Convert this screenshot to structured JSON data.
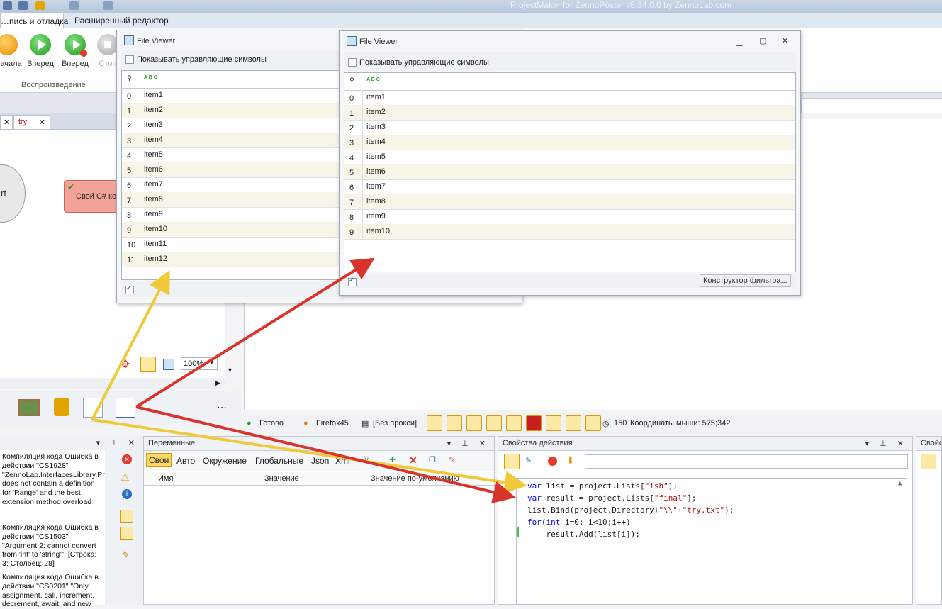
{
  "window": {
    "title": "ProjectMaker for ZennoPoster v5.34.0.0 by ZennoLab.com"
  },
  "ribbon": {
    "tabs": [
      {
        "label": "…пись и отладка"
      },
      {
        "label": "Расширенный редактор"
      }
    ],
    "buttons": [
      {
        "label": "…ачала"
      },
      {
        "label": "Вперед"
      },
      {
        "label": "Вперед"
      },
      {
        "label": "Стоп"
      }
    ],
    "group_label": "Воспроизведение"
  },
  "doc_tabs": [
    {
      "label": "try",
      "close": "✕"
    }
  ],
  "canvas": {
    "start_label": "rt",
    "action_label": "Свой C# ко",
    "zoom": "100%"
  },
  "file_viewer_1": {
    "title": "File Viewer",
    "show_control_chars": "Показывать управляющие символы",
    "header_icon": "A B C",
    "rows": [
      {
        "i": "0",
        "v": "item1"
      },
      {
        "i": "1",
        "v": "item2"
      },
      {
        "i": "2",
        "v": "item3"
      },
      {
        "i": "3",
        "v": "item4"
      },
      {
        "i": "4",
        "v": "item5"
      },
      {
        "i": "5",
        "v": "item6"
      },
      {
        "i": "6",
        "v": "item7"
      },
      {
        "i": "7",
        "v": "item8"
      },
      {
        "i": "8",
        "v": "item9"
      },
      {
        "i": "9",
        "v": "item10"
      },
      {
        "i": "10",
        "v": "item11"
      },
      {
        "i": "11",
        "v": "item12"
      }
    ]
  },
  "file_viewer_2": {
    "title": "File Viewer",
    "show_control_chars": "Показывать управляющие символы",
    "header_icon": "A B C",
    "filter_button": "Конструктор фильтра...",
    "rows": [
      {
        "i": "0",
        "v": "item1"
      },
      {
        "i": "1",
        "v": "item2"
      },
      {
        "i": "2",
        "v": "item3"
      },
      {
        "i": "3",
        "v": "item4"
      },
      {
        "i": "4",
        "v": "item5"
      },
      {
        "i": "5",
        "v": "item6"
      },
      {
        "i": "6",
        "v": "item7"
      },
      {
        "i": "7",
        "v": "item8"
      },
      {
        "i": "8",
        "v": "item9"
      },
      {
        "i": "9",
        "v": "item10"
      }
    ]
  },
  "status": {
    "ready": "Готово",
    "browser": "Firefox45",
    "proxy": "[Без прокси]",
    "counter": "150",
    "mouse": "Координаты мыши: 575;342"
  },
  "errors": [
    {
      "text": "Компиляция кода  Ошибка в действии \"CS1928\" \"ZennoLab.InterfacesLibrary.ProjectModel.IZennoList' does not contain a definition for 'Range' and the best extension method overload"
    },
    {
      "text": "Компиляция кода  Ошибка в действии \"CS1503\" \"Argument 2: cannot convert from 'int' to 'string'\". [Строка: 3; Столбец: 28]"
    },
    {
      "text": "Компиляция кода  Ошибка в действии \"CS0201\" \"Only assignment, call, increment, decrement, await, and new"
    }
  ],
  "variables": {
    "title": "Переменные",
    "tabs": [
      {
        "label": "Свои"
      },
      {
        "label": "Авто"
      },
      {
        "label": "Окружение"
      },
      {
        "label": "Глобальные"
      },
      {
        "label": "Json"
      },
      {
        "label": "Xml"
      }
    ],
    "columns": [
      {
        "label": "Имя"
      },
      {
        "label": "Значение"
      },
      {
        "label": "Значение по-умолчанию"
      }
    ]
  },
  "action_props": {
    "title": "Свойства действия"
  },
  "right_panel": {
    "title": "Свойс"
  },
  "code": {
    "lines": [
      [
        {
          "t": "var",
          "c": "kw"
        },
        {
          "t": " list = project.Lists[",
          "c": ""
        },
        {
          "t": "\"ish\"",
          "c": "str"
        },
        {
          "t": "];",
          "c": ""
        }
      ],
      [
        {
          "t": "var",
          "c": "kw"
        },
        {
          "t": " result = project.Lists[",
          "c": ""
        },
        {
          "t": "\"final\"",
          "c": "str"
        },
        {
          "t": "];",
          "c": ""
        }
      ],
      [
        {
          "t": "list.Bind(project.Directory+",
          "c": ""
        },
        {
          "t": "\"\\\\\"",
          "c": "str"
        },
        {
          "t": "+",
          "c": ""
        },
        {
          "t": "\"try.txt\"",
          "c": "str"
        },
        {
          "t": ");",
          "c": ""
        }
      ],
      [
        {
          "t": "for",
          "c": "kw"
        },
        {
          "t": "(",
          "c": ""
        },
        {
          "t": "int",
          "c": "kw"
        },
        {
          "t": " i=0; i<10;i++)",
          "c": ""
        }
      ],
      [
        {
          "t": "    result.Add(list[i]);",
          "c": ""
        }
      ]
    ]
  },
  "colors": {
    "arrow_yellow": "#f0c93a",
    "arrow_red": "#d9342b",
    "accent": "#1e9a1e"
  }
}
